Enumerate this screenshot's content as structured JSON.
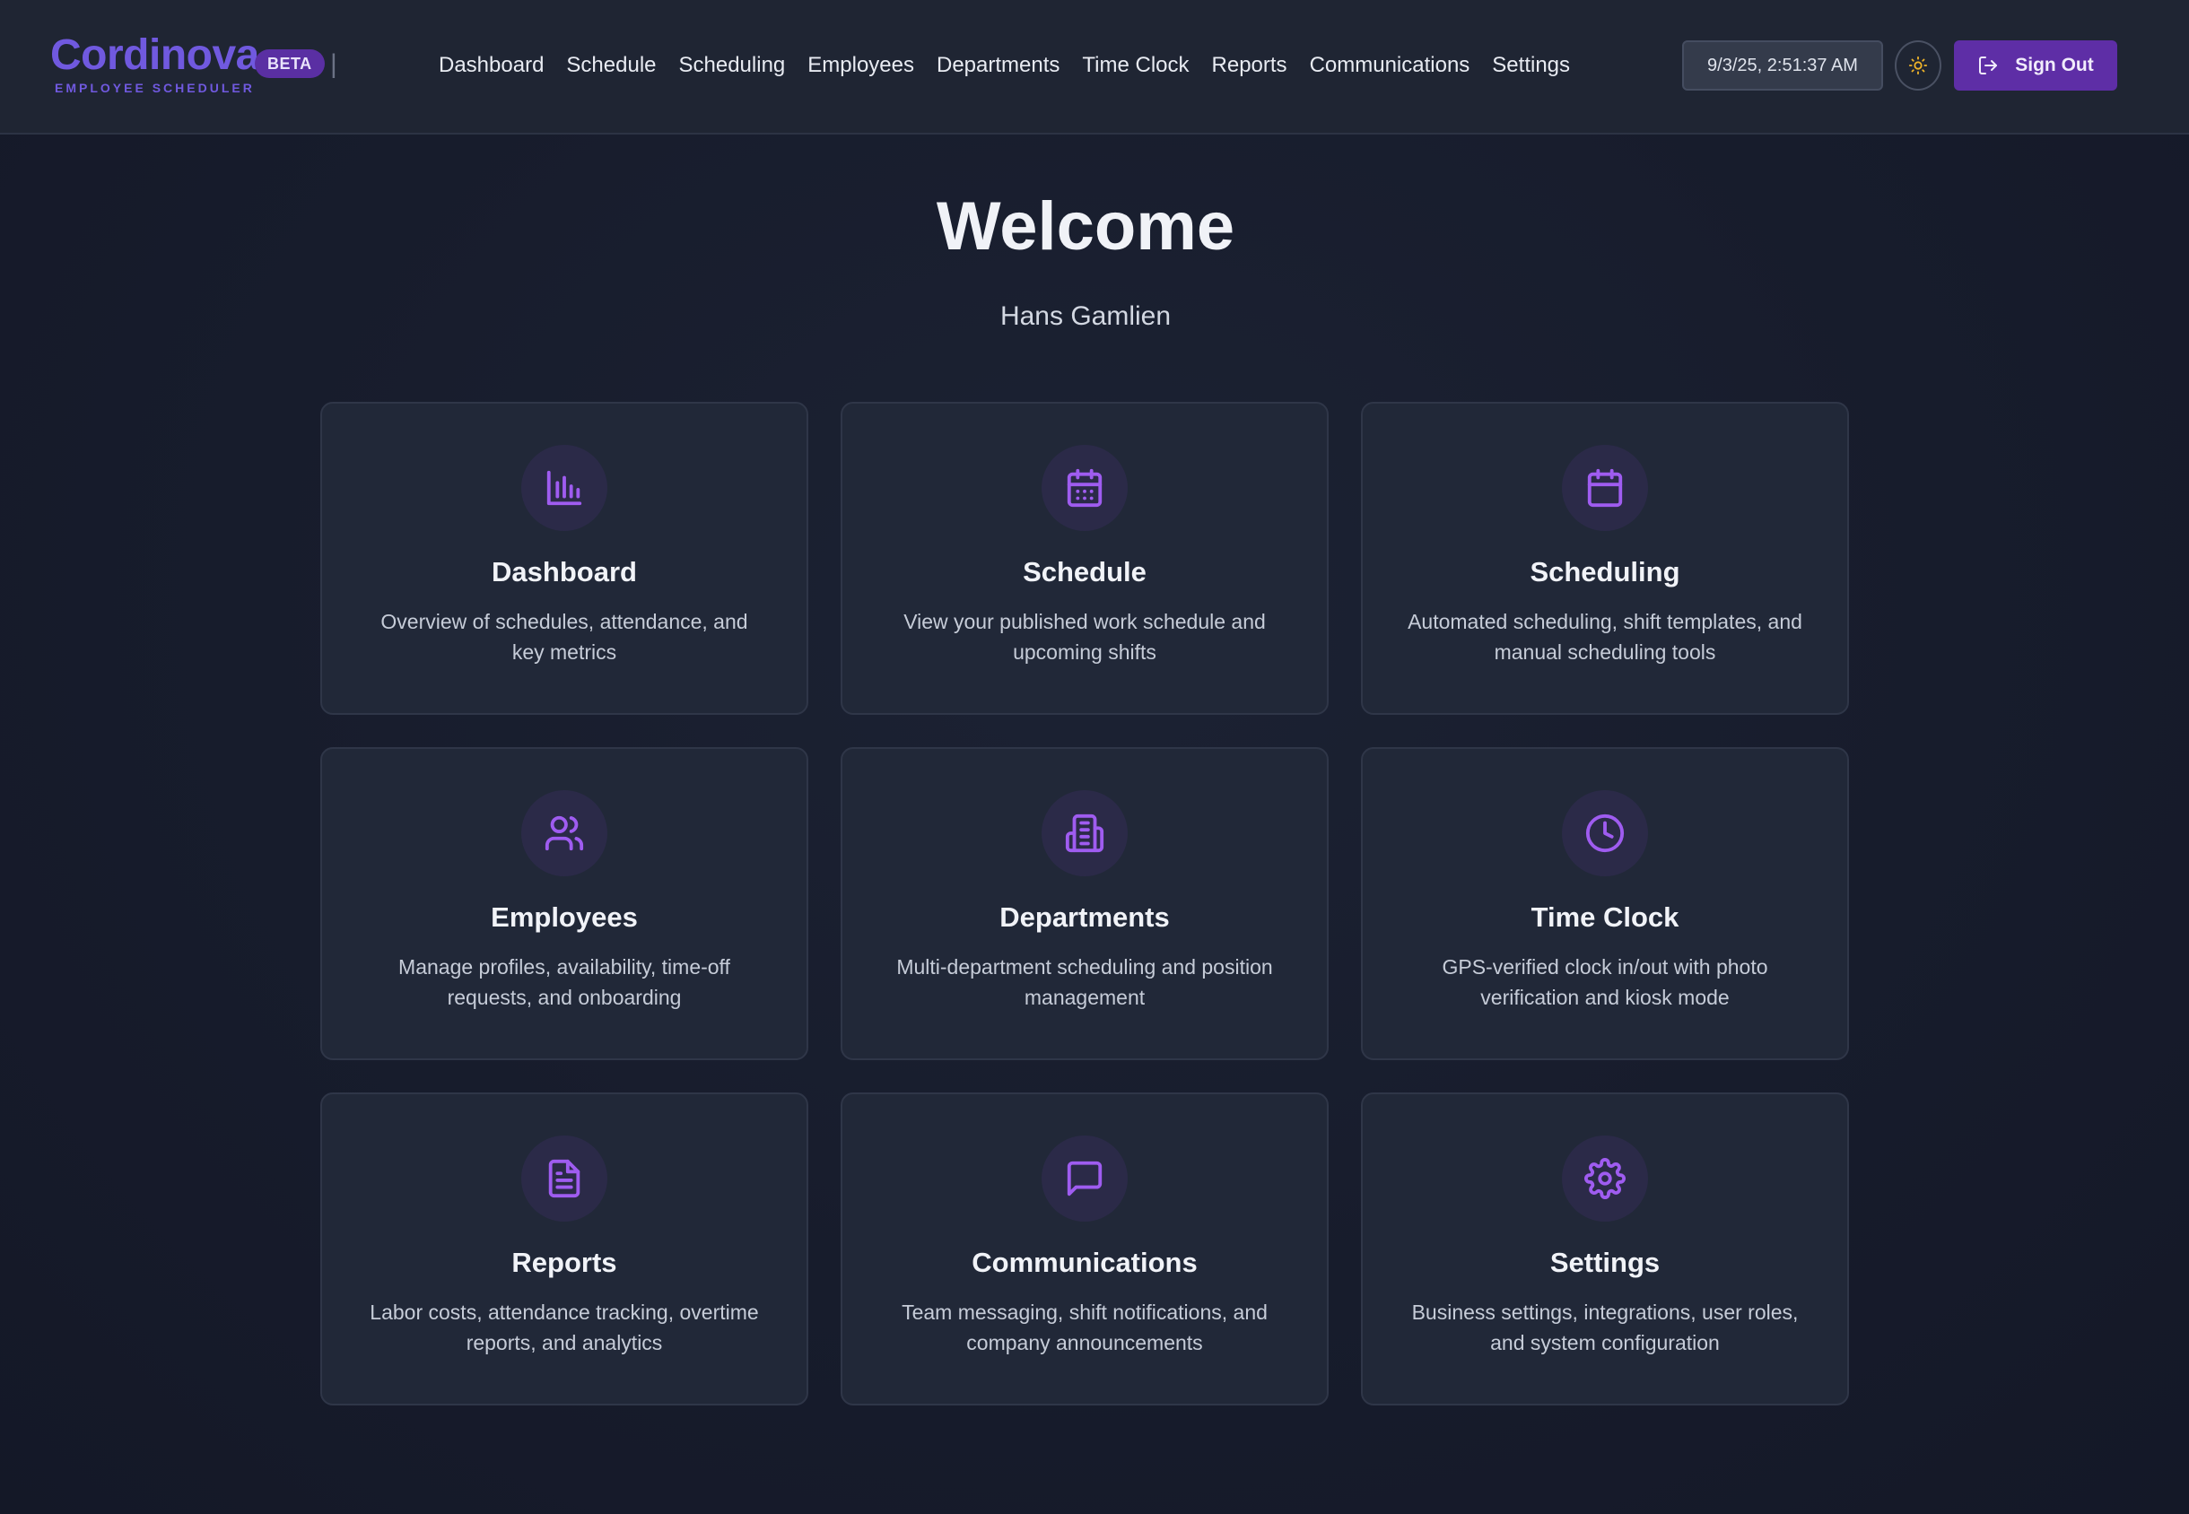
{
  "brand": {
    "name": "Cordinova",
    "subtitle": "EMPLOYEE SCHEDULER",
    "badge": "BETA",
    "separator": "|",
    "accent_color": "#7059df"
  },
  "nav": {
    "items": [
      {
        "label": "Dashboard"
      },
      {
        "label": "Schedule"
      },
      {
        "label": "Scheduling"
      },
      {
        "label": "Employees"
      },
      {
        "label": "Departments"
      },
      {
        "label": "Time Clock"
      },
      {
        "label": "Reports"
      },
      {
        "label": "Communications"
      },
      {
        "label": "Settings"
      }
    ]
  },
  "header": {
    "datetime": "9/3/25, 2:51:37 AM",
    "theme_toggle_icon": "sun-icon",
    "signout_label": "Sign Out",
    "signout_icon": "sign-out-icon",
    "signout_color": "#5e2ea6"
  },
  "main": {
    "welcome": "Welcome",
    "user_name": "Hans Gamlien"
  },
  "cards": [
    {
      "title": "Dashboard",
      "description": "Overview of schedules, attendance, and key metrics",
      "icon": "bar-chart-icon"
    },
    {
      "title": "Schedule",
      "description": "View your published work schedule and upcoming shifts",
      "icon": "calendar-days-icon"
    },
    {
      "title": "Scheduling",
      "description": "Automated scheduling, shift templates, and manual scheduling tools",
      "icon": "calendar-icon"
    },
    {
      "title": "Employees",
      "description": "Manage profiles, availability, time-off requests, and onboarding",
      "icon": "users-icon"
    },
    {
      "title": "Departments",
      "description": "Multi-department scheduling and position management",
      "icon": "building-icon"
    },
    {
      "title": "Time Clock",
      "description": "GPS-verified clock in/out with photo verification and kiosk mode",
      "icon": "clock-icon"
    },
    {
      "title": "Reports",
      "description": "Labor costs, attendance tracking, overtime reports, and analytics",
      "icon": "file-text-icon"
    },
    {
      "title": "Communications",
      "description": "Team messaging, shift notifications, and company announcements",
      "icon": "message-square-icon"
    },
    {
      "title": "Settings",
      "description": "Business settings, integrations, user roles, and system configuration",
      "icon": "gear-icon"
    }
  ]
}
